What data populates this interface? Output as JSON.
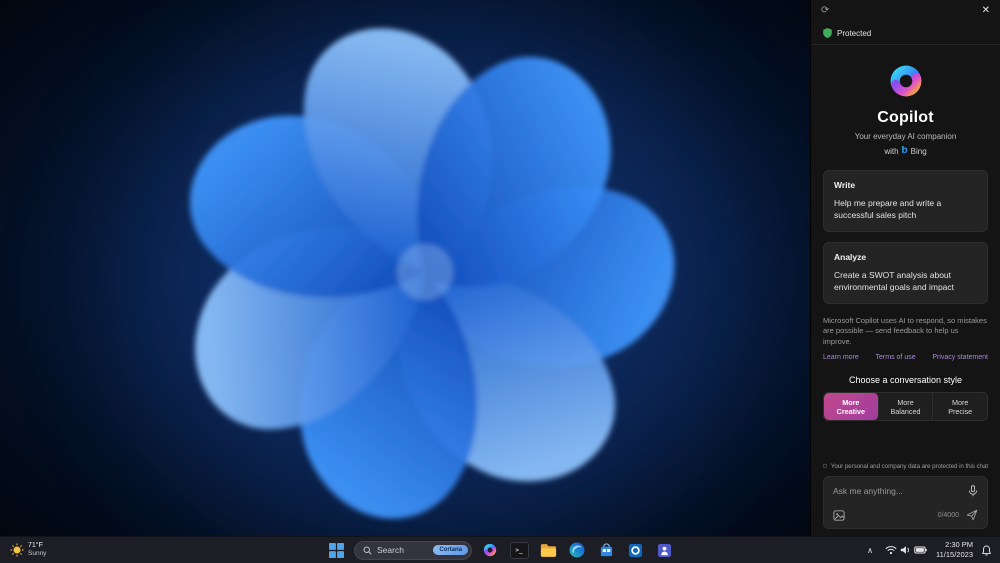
{
  "colors": {
    "accent_magenta": "#bf4a92",
    "protected_green": "#3fae58",
    "link_purple": "#a78bd8",
    "taskbar_bg": "#1d1d26"
  },
  "icons": {
    "close": "✕",
    "refresh": "⟳",
    "chevron_up": "∧",
    "terminal_prompt": ">_"
  },
  "sidebar": {
    "protected_label": "Protected",
    "brand": {
      "title": "Copilot",
      "subtitle": "Your everyday AI companion",
      "with_label": "with",
      "bing_label": "Bing"
    },
    "cards": [
      {
        "title": "Write",
        "body": "Help me prepare and write a successful sales pitch"
      },
      {
        "title": "Analyze",
        "body": "Create a SWOT analysis about environmental goals and impact"
      }
    ],
    "disclaimer": "Microsoft Copilot uses AI to respond, so mistakes are possible — send feedback to help us improve.",
    "links": [
      {
        "label": "Learn more"
      },
      {
        "label": "Terms of use"
      },
      {
        "label": "Privacy statement"
      }
    ],
    "style_chooser": {
      "title": "Choose a conversation style",
      "options": [
        {
          "label": "More\nCreative",
          "selected": true
        },
        {
          "label": "More\nBalanced",
          "selected": false
        },
        {
          "label": "More\nPrecise",
          "selected": false
        }
      ]
    },
    "privacy_note": "Your personal and company data are protected in this chat",
    "composer": {
      "placeholder": "Ask me anything...",
      "counter": "0/4000"
    }
  },
  "taskbar": {
    "weather": {
      "temp": "71°F",
      "condition": "Sunny"
    },
    "search": {
      "label": "Search",
      "badge": "Cortana"
    },
    "tray": {
      "time": "2:30 PM",
      "date": "11/15/2023"
    }
  }
}
